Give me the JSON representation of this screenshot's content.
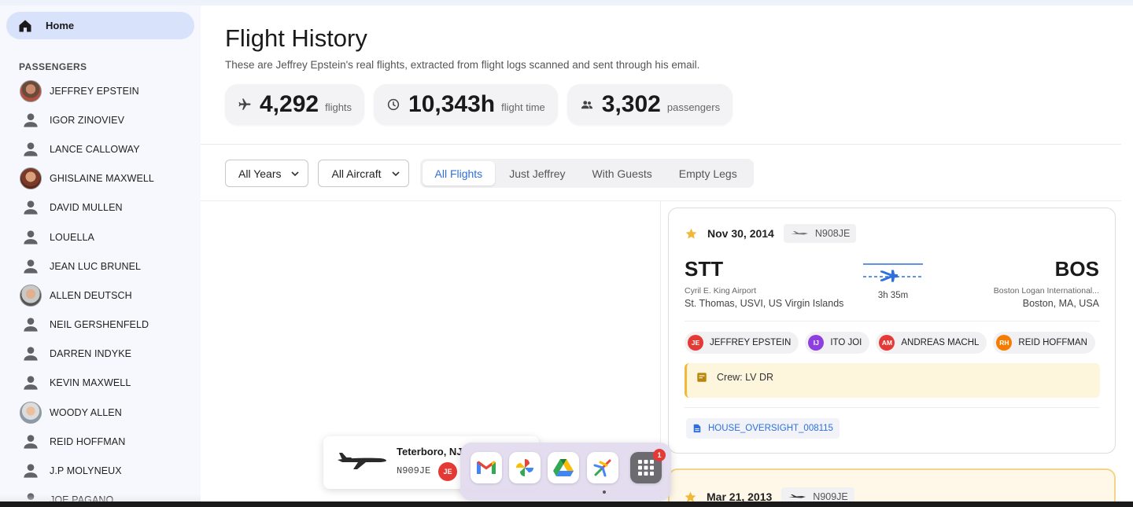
{
  "nav": {
    "home_label": "Home"
  },
  "sidebar": {
    "section_title": "PASSENGERS",
    "passengers": [
      {
        "name": "JEFFREY EPSTEIN",
        "avatar": "photo"
      },
      {
        "name": "IGOR ZINOVIEV",
        "avatar": "person-icon"
      },
      {
        "name": "LANCE CALLOWAY",
        "avatar": "person-icon"
      },
      {
        "name": "GHISLAINE MAXWELL",
        "avatar": "photo"
      },
      {
        "name": "DAVID MULLEN",
        "avatar": "person-icon"
      },
      {
        "name": "LOUELLA",
        "avatar": "person-icon"
      },
      {
        "name": "JEAN LUC BRUNEL",
        "avatar": "person-icon"
      },
      {
        "name": "ALLEN DEUTSCH",
        "avatar": "photo"
      },
      {
        "name": "NEIL GERSHENFELD",
        "avatar": "person-icon"
      },
      {
        "name": "DARREN INDYKE",
        "avatar": "person-icon"
      },
      {
        "name": "KEVIN MAXWELL",
        "avatar": "person-icon"
      },
      {
        "name": "WOODY ALLEN",
        "avatar": "photo"
      },
      {
        "name": "REID HOFFMAN",
        "avatar": "person-icon"
      },
      {
        "name": "J.P MOLYNEUX",
        "avatar": "person-icon"
      },
      {
        "name": "JOE PAGANO",
        "avatar": "person-icon"
      }
    ]
  },
  "header": {
    "title": "Flight History",
    "subtitle": "These are Jeffrey Epstein's real flights, extracted from flight logs scanned and sent through his email."
  },
  "stats": [
    {
      "icon": "airplane-icon",
      "value": "4,292",
      "unit": "flights"
    },
    {
      "icon": "clock-icon",
      "value": "10,343h",
      "unit": "flight time"
    },
    {
      "icon": "people-icon",
      "value": "3,302",
      "unit": "passengers"
    }
  ],
  "filters": {
    "years": "All Years",
    "aircraft": "All Aircraft",
    "segments": [
      "All Flights",
      "Just Jeffrey",
      "With Guests",
      "Empty Legs"
    ],
    "active_segment": "All Flights"
  },
  "flight": {
    "date": "Nov 30, 2014",
    "tail": "N908JE",
    "origin": {
      "code": "STT",
      "airport": "Cyril E. King Airport",
      "city": "St. Thomas, USVI, US Virgin Islands"
    },
    "destination": {
      "code": "BOS",
      "airport": "Boston Logan International...",
      "city": "Boston, MA, USA"
    },
    "duration": "3h 35m",
    "passengers": [
      {
        "initials": "JE",
        "name": "JEFFREY EPSTEIN",
        "color": "#e53935"
      },
      {
        "initials": "IJ",
        "name": "ITO JOI",
        "color": "#8e3fe0"
      },
      {
        "initials": "AM",
        "name": "ANDREAS MACHL",
        "color": "#e53935"
      },
      {
        "initials": "RH",
        "name": "REID HOFFMAN",
        "color": "#f57c00"
      }
    ],
    "crew": "Crew: LV DR",
    "document": "HOUSE_OVERSIGHT_008115"
  },
  "flight2": {
    "date": "Mar 21, 2013",
    "tail": "N909JE"
  },
  "toast": {
    "location": "Teterboro, NJ",
    "tail": "N909JE",
    "initials": "JE"
  },
  "dock": {
    "apps": [
      "gmail-icon",
      "google-photos-icon",
      "google-drive-icon",
      "flights-app-icon",
      "app-launcher-icon"
    ],
    "launcher_badge": "1"
  },
  "colors": {
    "accent": "#2f6fde",
    "highlight": "#fdf5dc",
    "star": "#f0b93a"
  }
}
